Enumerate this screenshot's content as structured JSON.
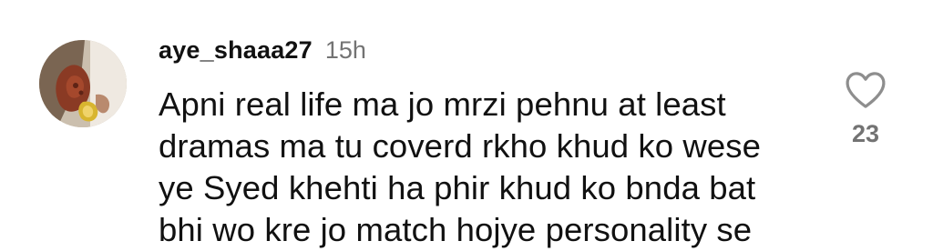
{
  "comment": {
    "username": "aye_shaaa27",
    "timestamp": "15h",
    "text_lines": [
      "Apni real life ma jo mrzi pehnu at least",
      "dramas ma tu coverd rkho khud ko wese",
      "ye Syed khehti ha phir khud ko bnda bat",
      "bhi wo kre jo match hojye personality se"
    ],
    "like_count": "23",
    "icons": {
      "like": "heart-outline-icon",
      "avatar": "profile-avatar"
    },
    "colors": {
      "text": "#111111",
      "meta": "#737373",
      "icon": "#8e8e8e"
    }
  }
}
